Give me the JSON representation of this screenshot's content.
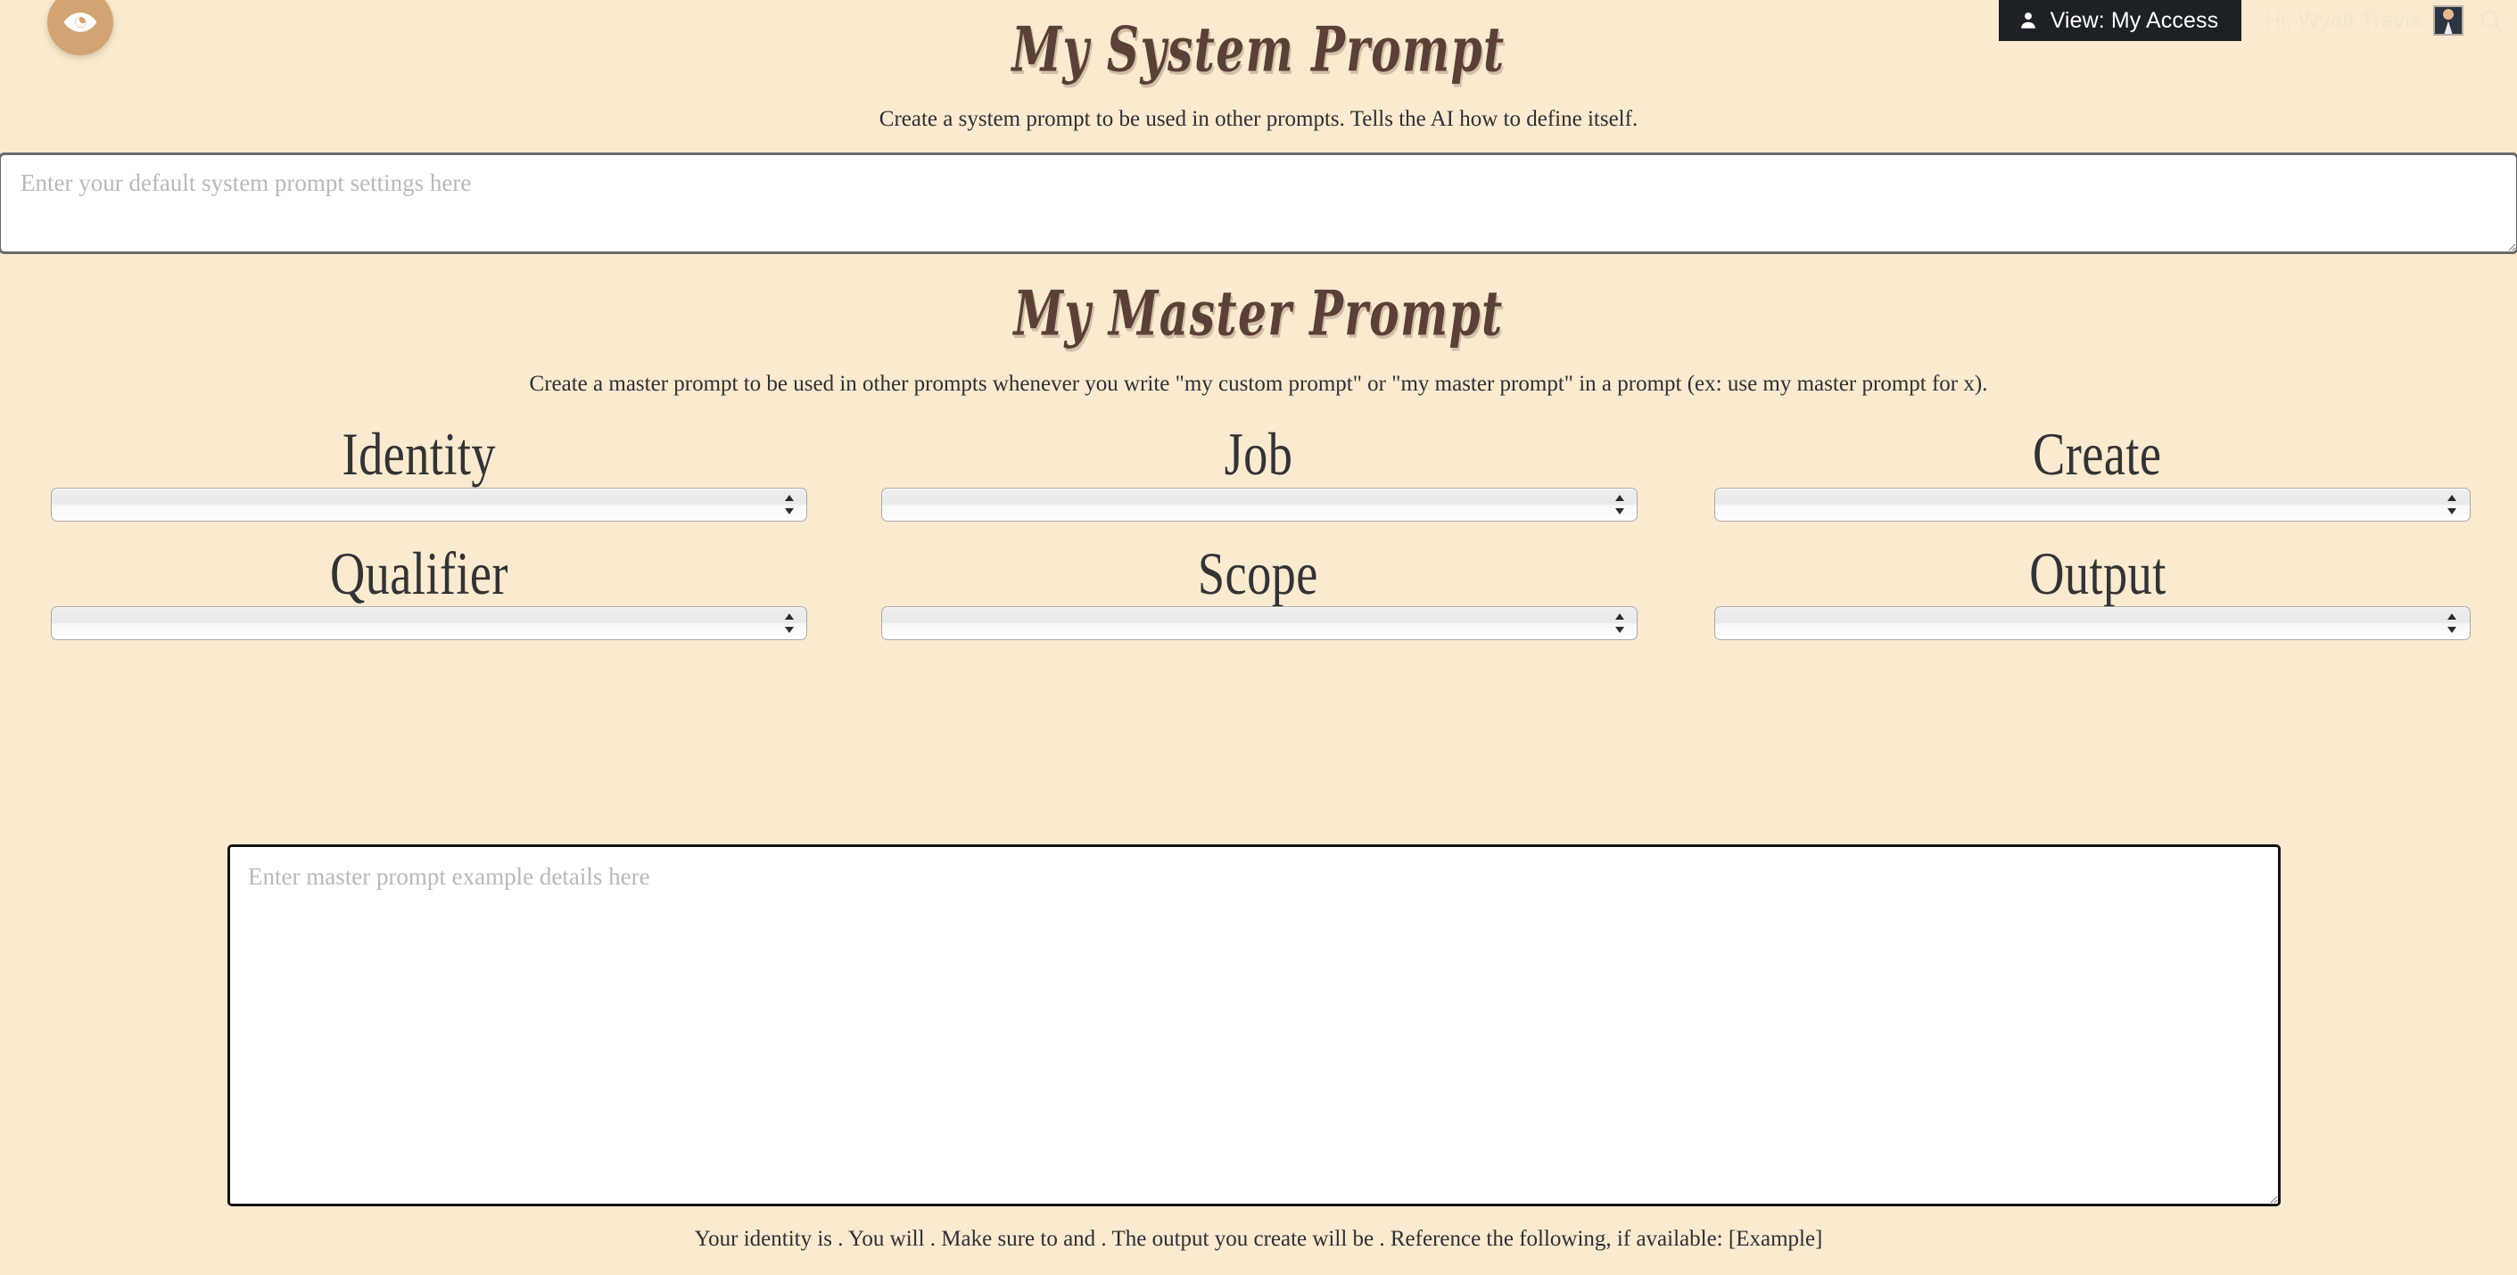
{
  "header": {
    "access_button_label": "View: My Access",
    "access_icon": "person-icon",
    "greeting": "Hi, Wyatt Travis",
    "avatar_icon": "avatar-image",
    "search_icon": "search-icon",
    "preview_icon": "eye-icon"
  },
  "system_section": {
    "title": "My System Prompt",
    "subtitle": "Create a system prompt to be used in other prompts. Tells the AI how to define itself.",
    "textarea_placeholder": "Enter your default system prompt settings here",
    "textarea_value": ""
  },
  "master_section": {
    "title": "My Master Prompt",
    "subtitle": "Create a master prompt to be used in other prompts whenever you write \"my custom prompt\" or \"my master prompt\" in a prompt (ex: use my master prompt for x).",
    "textarea_placeholder": "Enter master prompt example details here",
    "textarea_value": "",
    "footer_preview": "Your identity is . You will . Make sure to and . The output you create will be . Reference the following, if available: [Example]"
  },
  "selectors": [
    {
      "label": "Identity",
      "value": ""
    },
    {
      "label": "Job",
      "value": ""
    },
    {
      "label": "Create",
      "value": ""
    },
    {
      "label": "Qualifier",
      "value": ""
    },
    {
      "label": "Scope",
      "value": ""
    },
    {
      "label": "Output",
      "value": ""
    }
  ],
  "colors": {
    "background": "#f9ead0",
    "title_brown": "#5b4038",
    "accent_tan": "#d2a473",
    "pill_dark": "#1d2024",
    "body_text": "#2f2f33"
  }
}
